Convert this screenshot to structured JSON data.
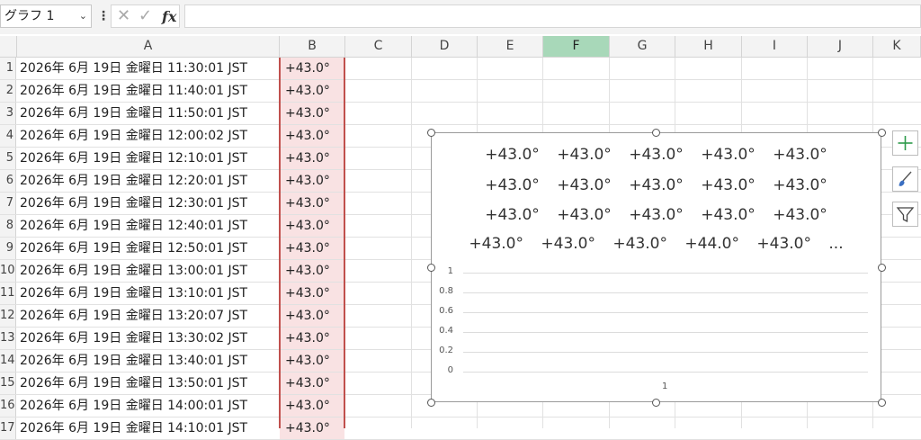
{
  "formula_bar": {
    "name_box": "グラフ 1",
    "cancel": "✕",
    "enter": "✓",
    "fx": "fx",
    "value": ""
  },
  "columns": [
    "A",
    "B",
    "C",
    "D",
    "E",
    "F",
    "G",
    "H",
    "I",
    "J",
    "K"
  ],
  "selected_column": "F",
  "rows": [
    {
      "n": "1",
      "a": "2026年 6月 19日 金曜日 11:30:01 JST",
      "b": "+43.0°"
    },
    {
      "n": "2",
      "a": "2026年 6月 19日 金曜日 11:40:01 JST",
      "b": "+43.0°"
    },
    {
      "n": "3",
      "a": "2026年 6月 19日 金曜日 11:50:01 JST",
      "b": "+43.0°"
    },
    {
      "n": "4",
      "a": "2026年 6月 19日 金曜日 12:00:02 JST",
      "b": "+43.0°"
    },
    {
      "n": "5",
      "a": "2026年 6月 19日 金曜日 12:10:01 JST",
      "b": "+43.0°"
    },
    {
      "n": "6",
      "a": "2026年 6月 19日 金曜日 12:20:01 JST",
      "b": "+43.0°"
    },
    {
      "n": "7",
      "a": "2026年 6月 19日 金曜日 12:30:01 JST",
      "b": "+43.0°"
    },
    {
      "n": "8",
      "a": "2026年 6月 19日 金曜日 12:40:01 JST",
      "b": "+43.0°"
    },
    {
      "n": "9",
      "a": "2026年 6月 19日 金曜日 12:50:01 JST",
      "b": "+43.0°"
    },
    {
      "n": "10",
      "a": "2026年 6月 19日 金曜日 13:00:01 JST",
      "b": "+43.0°"
    },
    {
      "n": "11",
      "a": "2026年 6月 19日 金曜日 13:10:01 JST",
      "b": "+43.0°"
    },
    {
      "n": "12",
      "a": "2026年 6月 19日 金曜日 13:20:07 JST",
      "b": "+43.0°"
    },
    {
      "n": "13",
      "a": "2026年 6月 19日 金曜日 13:30:02 JST",
      "b": "+43.0°"
    },
    {
      "n": "14",
      "a": "2026年 6月 19日 金曜日 13:40:01 JST",
      "b": "+43.0°"
    },
    {
      "n": "15",
      "a": "2026年 6月 19日 金曜日 13:50:01 JST",
      "b": "+43.0°"
    },
    {
      "n": "16",
      "a": "2026年 6月 19日 金曜日 14:00:01 JST",
      "b": "+43.0°"
    },
    {
      "n": "17",
      "a": "2026年 6月 19日 金曜日 14:10:01 JST",
      "b": "+43.0°"
    }
  ],
  "chart": {
    "title_lines": [
      "+43.0° +43.0° +43.0° +43.0° +43.0°",
      "+43.0° +43.0° +43.0° +43.0° +43.0°",
      "+43.0° +43.0° +43.0° +43.0° +43.0°",
      "+43.0° +43.0° +43.0° +44.0° +43.0° ..."
    ],
    "y_ticks": [
      "1",
      "0.8",
      "0.6",
      "0.4",
      "0.2",
      "0"
    ],
    "x_tick": "1"
  },
  "chart_data": {
    "type": "line",
    "ylim": [
      0,
      1
    ],
    "y_ticks": [
      0,
      0.2,
      0.4,
      0.6,
      0.8,
      1
    ],
    "x": [
      "1"
    ],
    "series": [],
    "grid": true
  },
  "side_buttons": [
    "plus-icon",
    "brush-icon",
    "filter-icon"
  ],
  "colors": {
    "selected_column": "#a8d8b9",
    "selection_border": "#c0504d",
    "selection_fill": "#f9e2e3",
    "plus": "#2e9b4b",
    "brush": "#3a6fc2"
  }
}
